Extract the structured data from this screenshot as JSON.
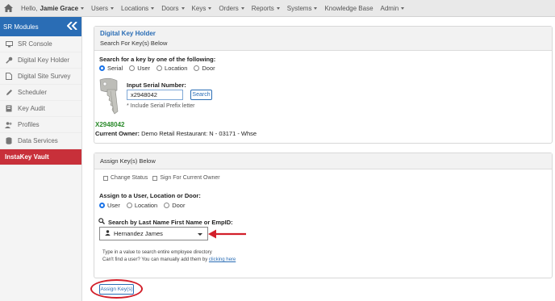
{
  "topnav": {
    "greeting": "Hello,",
    "user_name": "Jamie Grace",
    "items": [
      "Users",
      "Locations",
      "Doors",
      "Keys",
      "Orders",
      "Reports",
      "Systems",
      "Knowledge Base",
      "Admin"
    ]
  },
  "sidebar": {
    "title": "SR Modules",
    "items": [
      {
        "label": "SR Console",
        "icon": "monitor-icon"
      },
      {
        "label": "Digital Key Holder",
        "icon": "key-icon"
      },
      {
        "label": "Digital Site Survey",
        "icon": "document-icon"
      },
      {
        "label": "Scheduler",
        "icon": "pencil-icon"
      },
      {
        "label": "Key Audit",
        "icon": "audit-icon"
      },
      {
        "label": "Profiles",
        "icon": "users-icon"
      },
      {
        "label": "Data Services",
        "icon": "database-icon"
      },
      {
        "label": "InstaKey Vault",
        "icon": "vault-icon",
        "active": true
      }
    ]
  },
  "holder": {
    "title": "Digital Key Holder",
    "subtitle": "Search For Key(s) Below",
    "search_by_label": "Search for a key by one of the following:",
    "search_options": [
      "Serial",
      "User",
      "Location",
      "Door"
    ],
    "serial_label": "Input Serial Number:",
    "serial_value": "x2948042",
    "search_button": "Search",
    "hint": "* Include Serial Prefix letter",
    "result_serial": "X2948042",
    "current_owner_label": "Current Owner:",
    "current_owner_value": "Demo Retail Restaurant: N - 03171 - Whse"
  },
  "assign": {
    "title": "Assign Key(s) Below",
    "checkbox_change_status": "Change Status",
    "checkbox_sign": "Sign For Current Owner",
    "assign_to_label": "Assign to a User, Location or Door:",
    "assign_options": [
      "User",
      "Location",
      "Door"
    ],
    "search_label": "Search by Last Name First Name or EmpID:",
    "selected_user": "Hernandez James",
    "help1": "Type in a value to search entire employee directory",
    "help2_prefix": "Can't find a user? You can manually add them by",
    "help2_link": "clicking here",
    "assign_button": "Assign Key(s)"
  },
  "colors": {
    "accent": "#2a6db5",
    "active_sidebar": "#c8303a",
    "annotation": "#d21f2a",
    "result_green": "#2a8a2a"
  }
}
